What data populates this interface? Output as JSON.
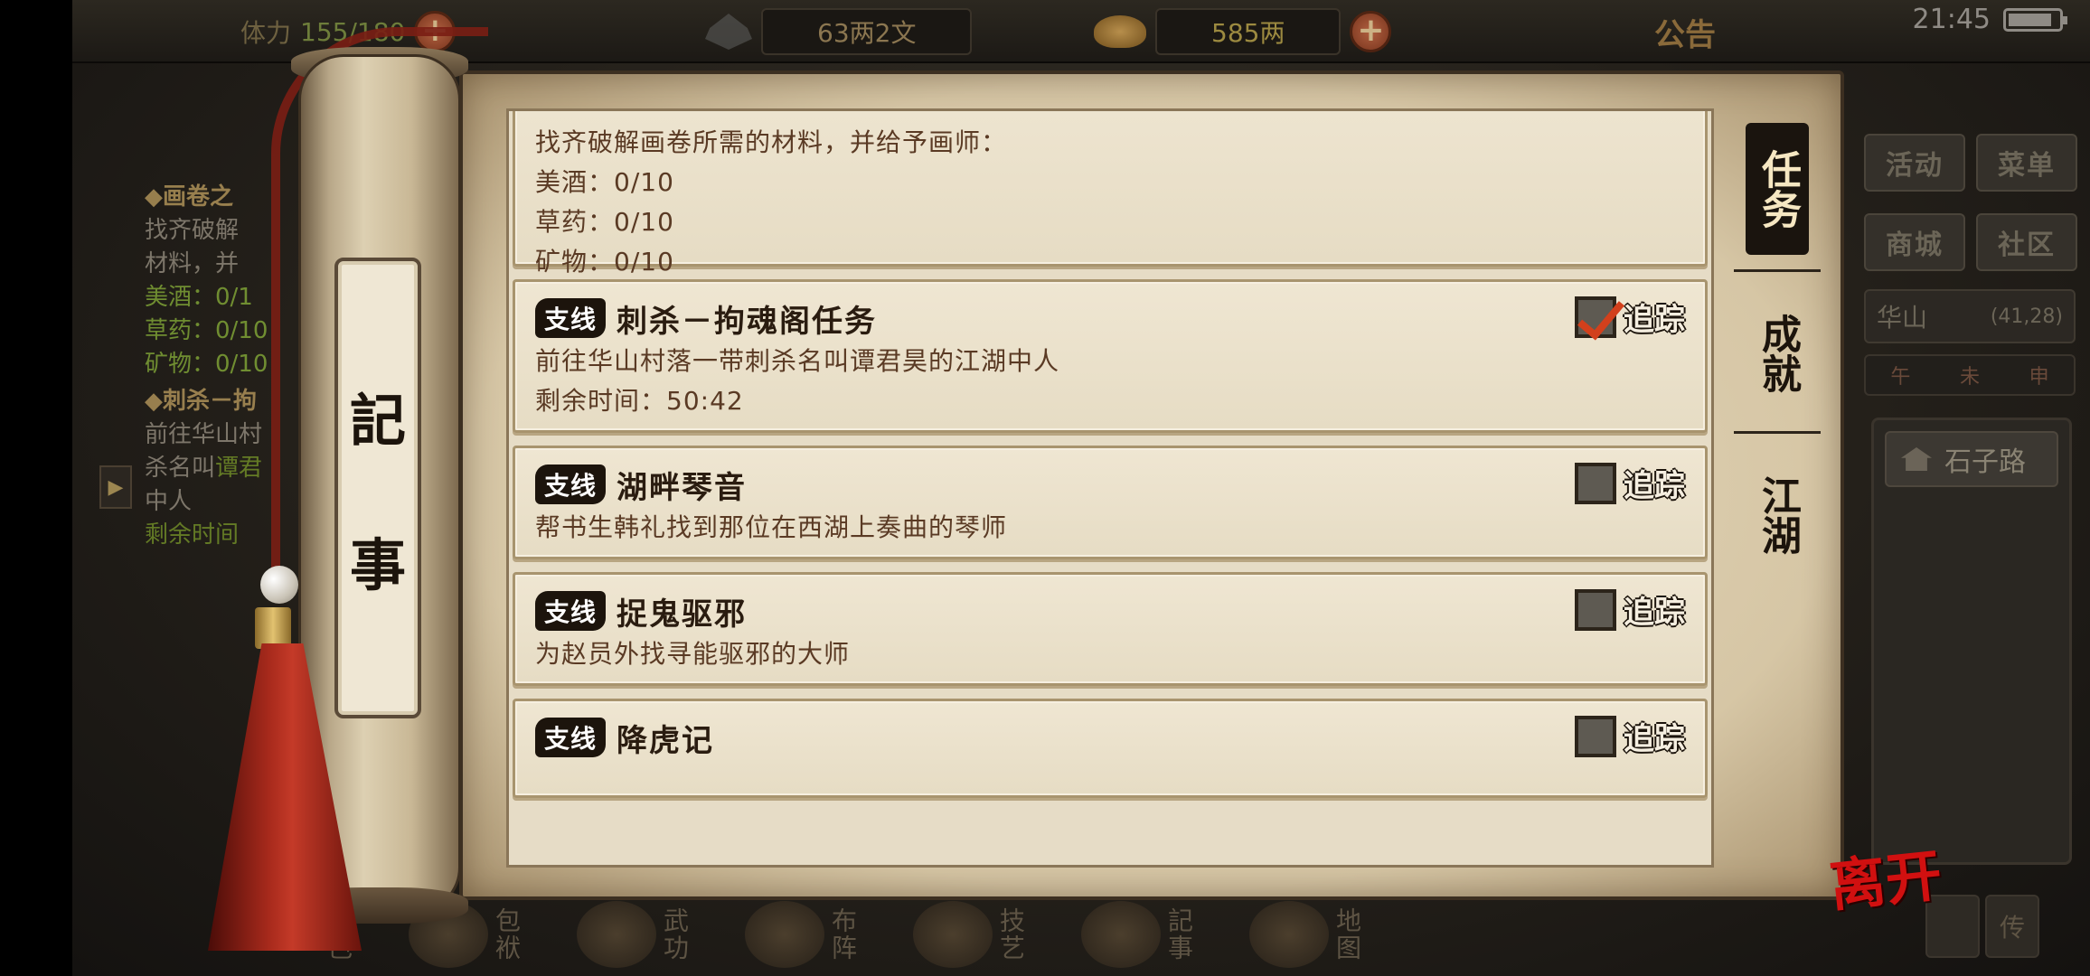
{
  "topbar": {
    "stamina_label": "体力",
    "stamina_value": "155/180",
    "copper": "63两2文",
    "silver": "585两",
    "notice": "公告"
  },
  "status": {
    "time": "21:45"
  },
  "tracker": {
    "quest1_title": "◆画卷之",
    "quest1_line1": "找齐破解",
    "quest1_line2": "材料，并",
    "quest1_item1": "美酒：0/1",
    "quest1_item2": "草药：0/10",
    "quest1_item3": "矿物：0/10",
    "quest2_title": "◆刺杀－拘",
    "quest2_line1": "前往华山村",
    "quest2_line2_a": "杀名叫",
    "quest2_line2_b": "谭君",
    "quest2_line3": "中人",
    "quest2_line4": "剩余时间"
  },
  "right_panel": {
    "activity": "活动",
    "menu": "菜单",
    "shop": "商城",
    "community": "社区",
    "location": "华山",
    "coords": "(41,28)",
    "compass": [
      "午",
      "未",
      "申"
    ],
    "road": "石子路"
  },
  "scroll": {
    "char1": "記",
    "char2": "事"
  },
  "tabs": {
    "quest": "任务",
    "achievement": "成就",
    "jianghu": "江湖"
  },
  "track_label": "追踪",
  "quests": [
    {
      "badge": "",
      "title": "",
      "desc": [
        "找齐破解画卷所需的材料，并给予画师：",
        "美酒：0/10",
        "草药：0/10",
        "矿物：0/10"
      ],
      "tracked": true
    },
    {
      "badge": "支线",
      "title": "刺杀－拘魂阁任务",
      "desc": [
        "前往华山村落一带刺杀名叫谭君昊的江湖中人",
        "剩余时间：50:42"
      ],
      "tracked": true
    },
    {
      "badge": "支线",
      "title": "湖畔琴音",
      "desc": [
        "帮书生韩礼找到那位在西湖上奏曲的琴师"
      ],
      "tracked": false
    },
    {
      "badge": "支线",
      "title": "捉鬼驱邪",
      "desc": [
        "为赵员外找寻能驱邪的大师"
      ],
      "tracked": false
    },
    {
      "badge": "支线",
      "title": "降虎记",
      "desc": [],
      "tracked": false
    }
  ],
  "bottom_nav": [
    "角色",
    "包袱",
    "武功",
    "布阵",
    "技艺",
    "記事",
    "地图"
  ],
  "bottom_right": [
    "",
    "传"
  ],
  "leave": "离开"
}
